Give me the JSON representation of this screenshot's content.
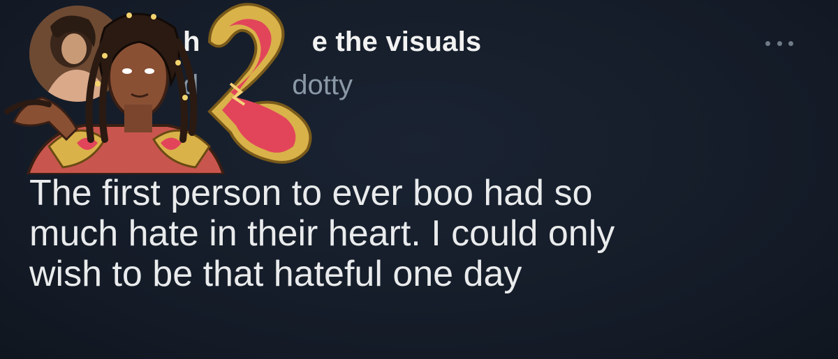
{
  "tweet": {
    "display_name_start": "h",
    "display_name_end": "e the visuals",
    "handle_start": "d",
    "handle_end": "dotty",
    "text_lines": [
      "The first person to ever boo had so",
      "much hate in their heart. I could only",
      "wish to be that hateful one day"
    ]
  },
  "icons": {
    "more": "more-horizontal-icon"
  },
  "colors": {
    "background": "#151d2a",
    "text": "#e9ebec",
    "handle": "#8b98a5",
    "heart_red": "#e2455a",
    "gold": "#d9b24a"
  }
}
